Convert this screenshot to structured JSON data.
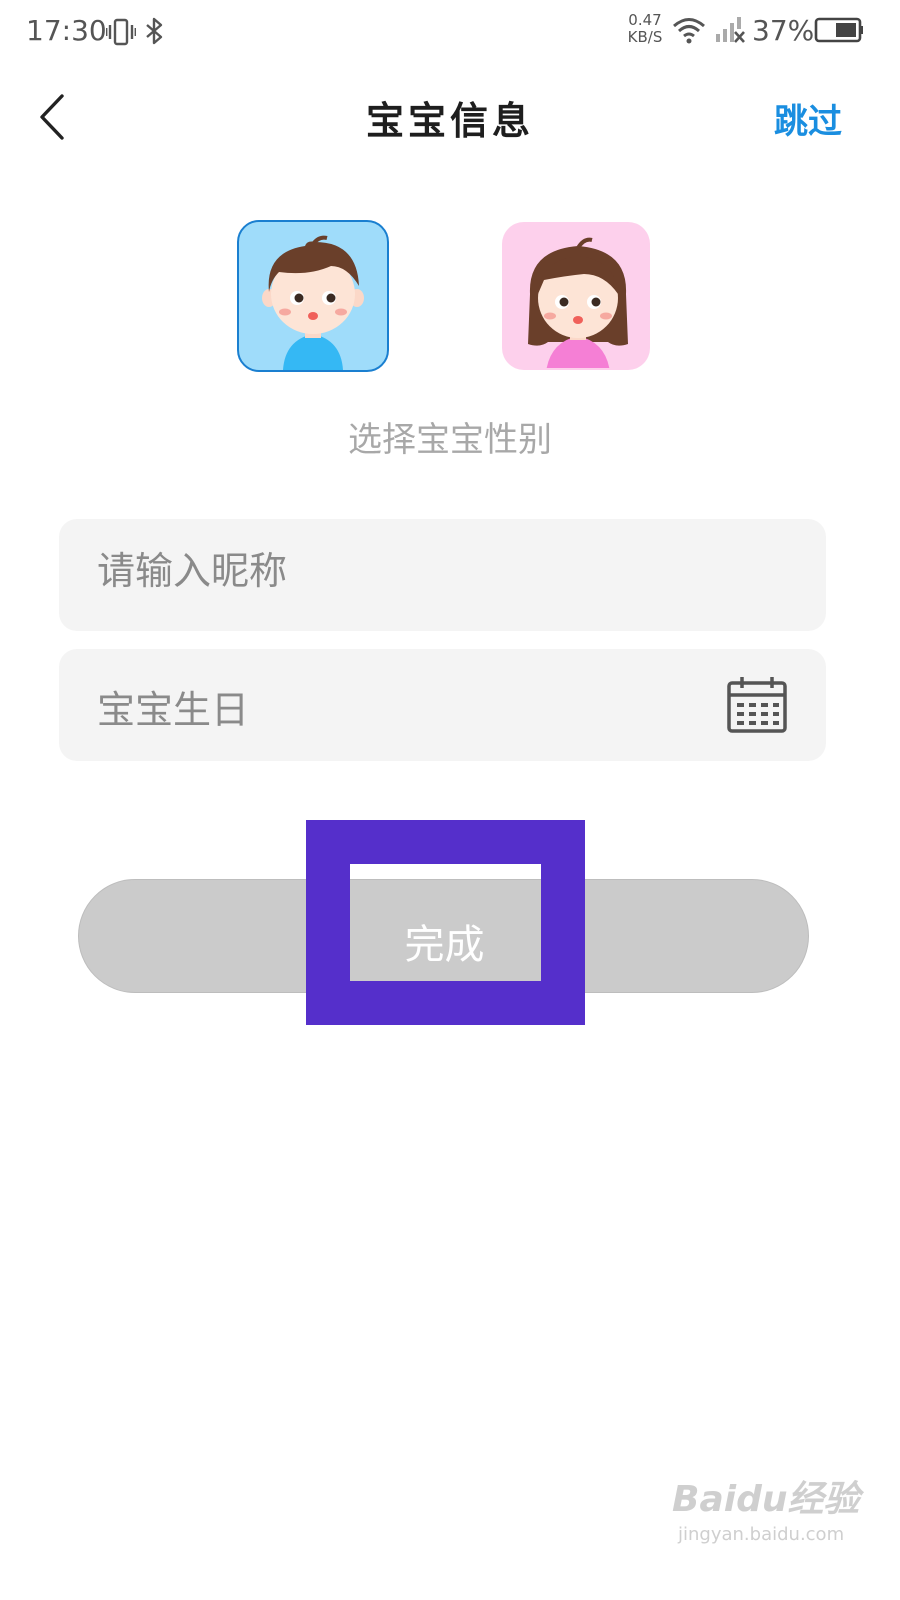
{
  "status_bar": {
    "time": "17:30",
    "net_speed_value": "0.47",
    "net_speed_unit": "KB/S",
    "battery_percent": "37%",
    "icons": [
      "vibrate-icon",
      "bluetooth-icon",
      "wifi-icon",
      "signal-no-service-icon",
      "battery-icon"
    ]
  },
  "header": {
    "title": "宝宝信息",
    "skip_label": "跳过",
    "back_icon": "chevron-left-icon"
  },
  "gender": {
    "caption": "选择宝宝性别",
    "options": [
      {
        "id": "boy",
        "icon": "boy-avatar-icon",
        "selected": true,
        "color": "#9fdcfa"
      },
      {
        "id": "girl",
        "icon": "girl-avatar-icon",
        "selected": false,
        "color": "#fdd0ec"
      }
    ]
  },
  "form": {
    "nickname_placeholder": "请输入昵称",
    "birthday_placeholder": "宝宝生日",
    "birthday_icon": "calendar-icon"
  },
  "actions": {
    "done_label": "完成"
  },
  "annotation": {
    "highlight_color": "#552fcb"
  },
  "watermark": {
    "brand": "Baidu经验",
    "url": "jingyan.baidu.com"
  },
  "colors": {
    "accent": "#1a8ee0",
    "button_disabled": "#cbcbcb",
    "field_bg": "#f4f4f4"
  }
}
